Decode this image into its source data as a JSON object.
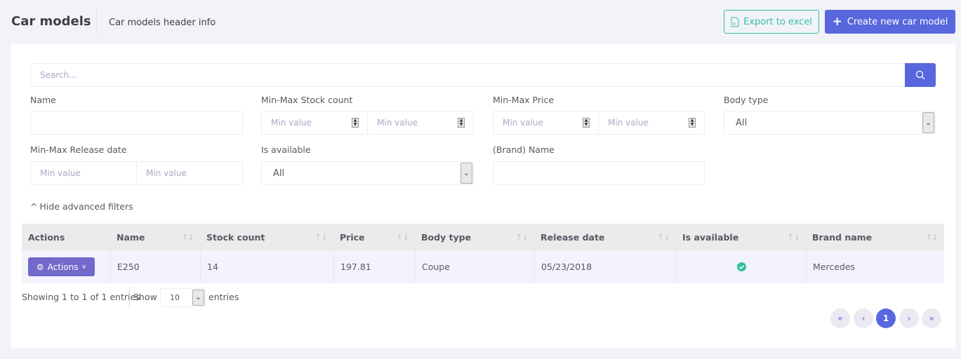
{
  "header": {
    "title": "Car models",
    "info": "Car models header info",
    "export_label": "Export to excel",
    "create_label": "Create new car model"
  },
  "search": {
    "placeholder": "Search..."
  },
  "filters": {
    "name_label": "Name",
    "stock_label": "Min-Max Stock count",
    "stock_min_placeholder": "Min value",
    "stock_max_placeholder": "Min value",
    "price_label": "Min-Max Price",
    "price_min_placeholder": "Min value",
    "price_max_placeholder": "Min value",
    "body_label": "Body type",
    "body_value": "All",
    "release_label": "Min-Max Release date",
    "release_min_placeholder": "Min value",
    "release_max_placeholder": "Min value",
    "available_label": "Is available",
    "available_value": "All",
    "brand_label": "(Brand) Name",
    "toggle_label": "Hide advanced filters"
  },
  "table": {
    "columns": [
      "Actions",
      "Name",
      "Stock count",
      "Price",
      "Body type",
      "Release date",
      "Is available",
      "Brand name"
    ],
    "rows": [
      {
        "actions_label": "Actions",
        "name": "E250",
        "stock": "14",
        "price": "197.81",
        "body": "Coupe",
        "release": "05/23/2018",
        "available": true,
        "brand": "Mercedes"
      }
    ]
  },
  "footer": {
    "showing": "Showing 1 to 1 of 1 entries",
    "show": "Show",
    "page_size": "10",
    "entries": "entries"
  },
  "pagination": {
    "current": "1"
  },
  "colors": {
    "primary": "#5867dd",
    "success": "#34bfa3",
    "actions": "#716aca"
  }
}
